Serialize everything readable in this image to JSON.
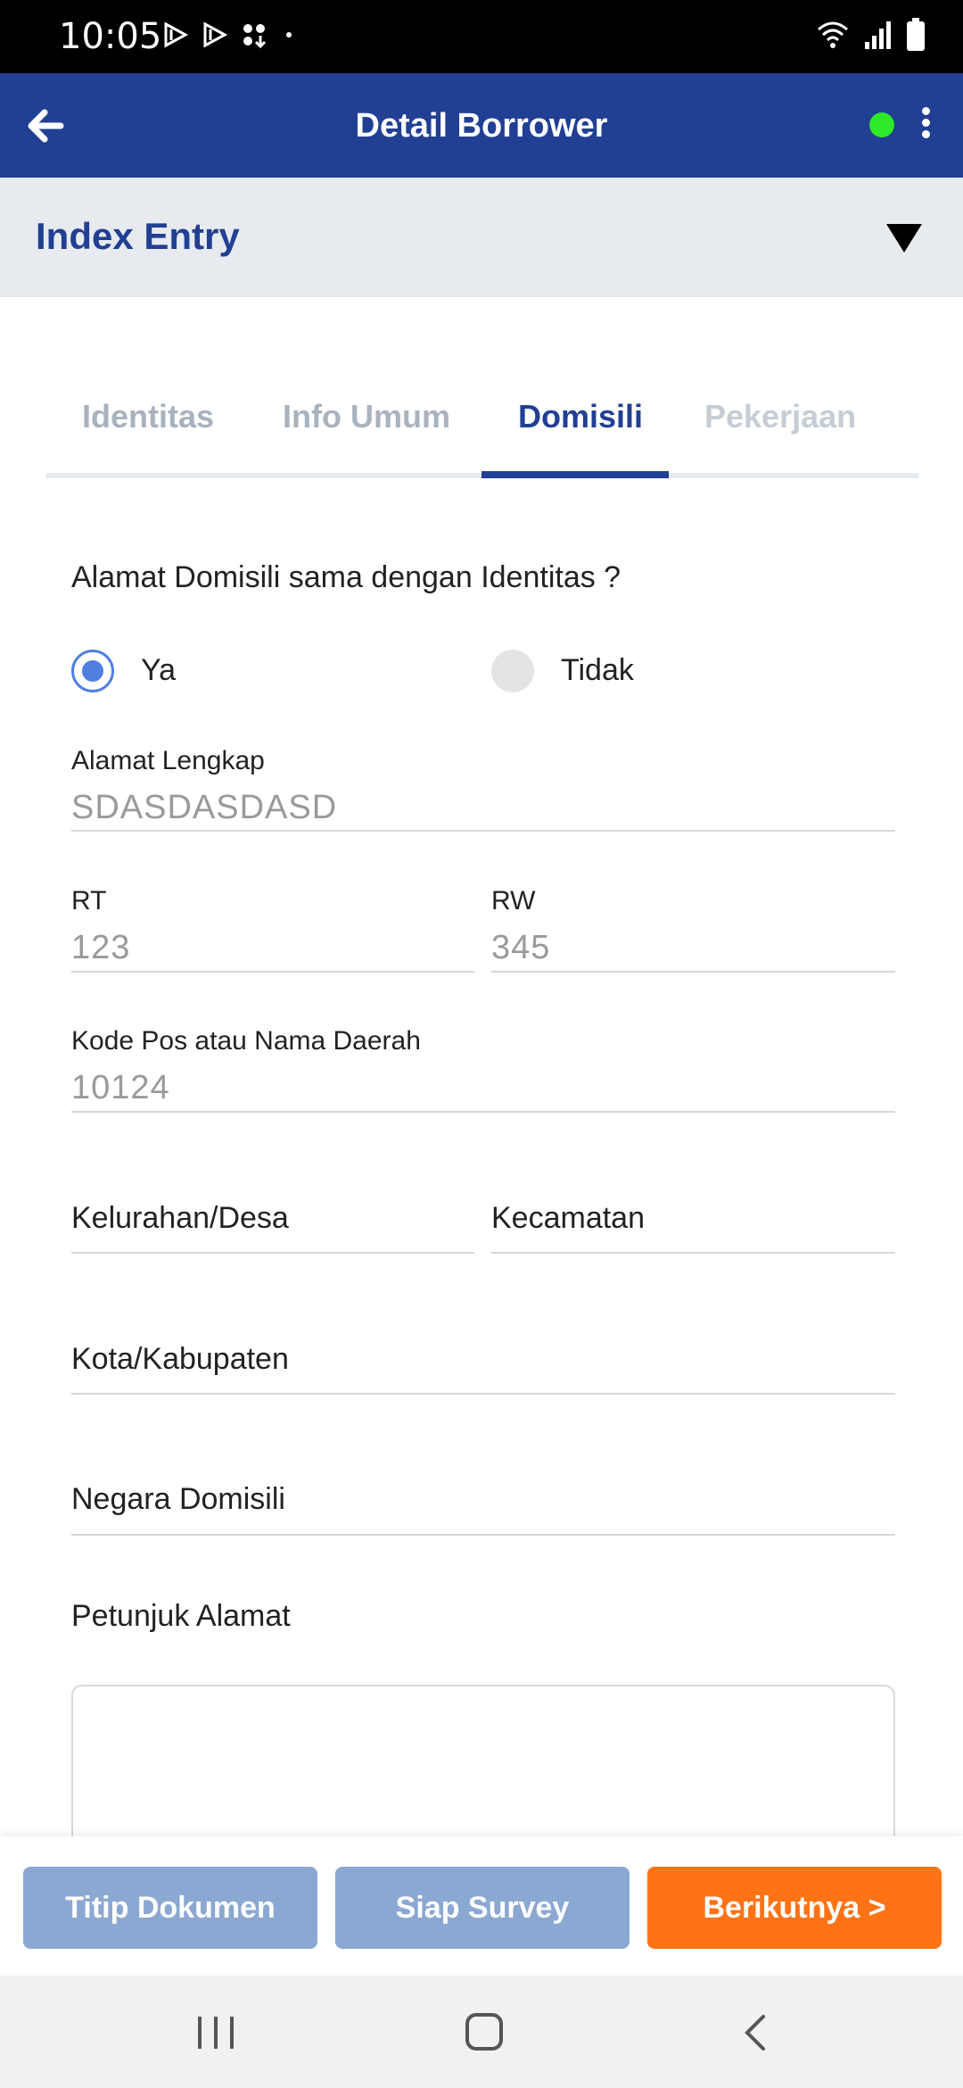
{
  "status_bar": {
    "time": "10:05"
  },
  "app_bar": {
    "title": "Detail Borrower",
    "online_dot_color": "#2ee82a"
  },
  "section": {
    "title": "Index Entry"
  },
  "tabs": [
    {
      "label": "Identitas",
      "active": false
    },
    {
      "label": "Info Umum",
      "active": false
    },
    {
      "label": "Domisili",
      "active": true
    },
    {
      "label": "Pekerjaan",
      "active": false
    }
  ],
  "form": {
    "same_address_question": "Alamat Domisili sama dengan Identitas ?",
    "options": [
      {
        "label": "Ya",
        "selected": true
      },
      {
        "label": "Tidak",
        "selected": false
      }
    ],
    "alamat_lengkap": {
      "label": "Alamat Lengkap",
      "value": "SDASDASDASD"
    },
    "rt": {
      "label": "RT",
      "value": "123"
    },
    "rw": {
      "label": "RW",
      "value": "345"
    },
    "kode_pos": {
      "label": "Kode Pos atau Nama Daerah",
      "value": "10124"
    },
    "kelurahan": {
      "label": "Kelurahan/Desa"
    },
    "kecamatan": {
      "label": "Kecamatan"
    },
    "kota": {
      "label": "Kota/Kabupaten"
    },
    "negara": {
      "label": "Negara Domisili"
    },
    "petunjuk": {
      "label": "Petunjuk Alamat"
    }
  },
  "actions": {
    "titip_dokumen": "Titip Dokumen",
    "siap_survey": "Siap Survey",
    "berikutnya": "Berikutnya >"
  },
  "colors": {
    "primary": "#213f93",
    "accent": "#ff7316",
    "secondary_button": "#8ba8d2",
    "radio_selected": "#4f7fe0"
  }
}
